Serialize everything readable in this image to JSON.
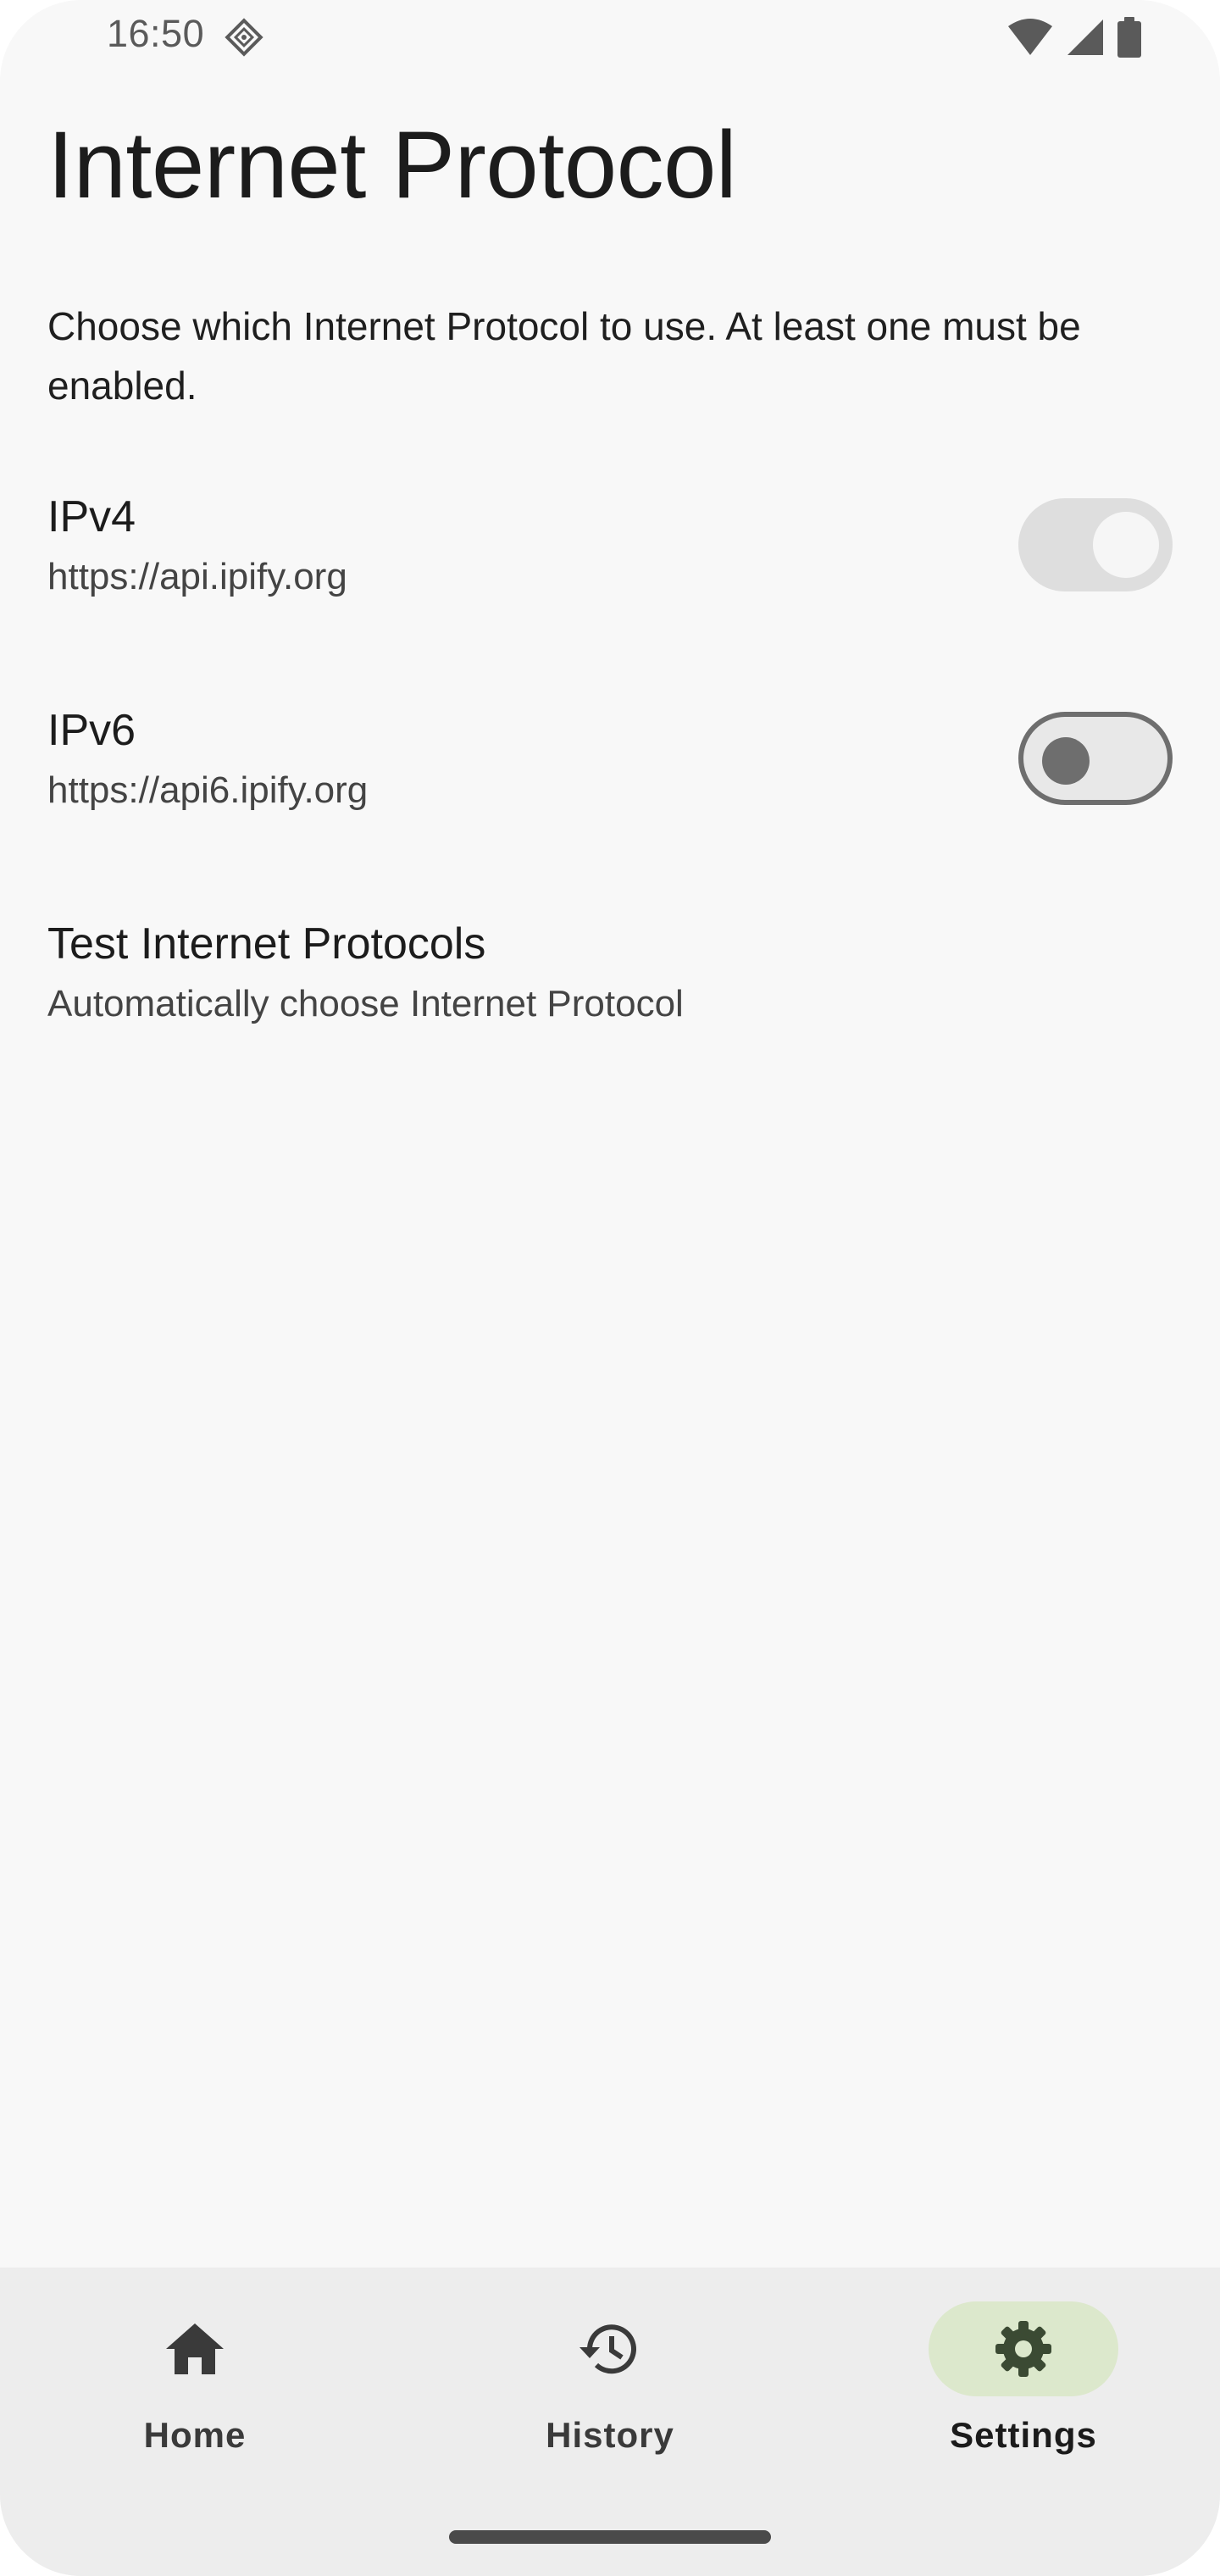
{
  "status_bar": {
    "time": "16:50",
    "app_icon": "diamond-grid-icon",
    "wifi_icon": "wifi-icon",
    "signal_icon": "cell-signal-icon",
    "battery_icon": "battery-icon"
  },
  "page": {
    "title": "Internet Protocol",
    "description": "Choose which Internet Protocol to use. At least one must be enabled."
  },
  "preferences": [
    {
      "title": "IPv4",
      "summary": "https://api.ipify.org",
      "switch_state": "on-disabled"
    },
    {
      "title": "IPv6",
      "summary": "https://api6.ipify.org",
      "switch_state": "off"
    },
    {
      "title": "Test Internet Protocols",
      "summary": "Automatically choose Internet Protocol"
    }
  ],
  "bottom_nav": {
    "items": [
      {
        "label": "Home",
        "icon": "home-icon",
        "active": false
      },
      {
        "label": "History",
        "icon": "history-icon",
        "active": false
      },
      {
        "label": "Settings",
        "icon": "gear-icon",
        "active": true
      }
    ]
  },
  "colors": {
    "background": "#f8f8f8",
    "nav_background": "#ededed",
    "active_indicator": "#dce8cc",
    "text_primary": "#1c1c1c",
    "text_secondary": "#444444"
  }
}
